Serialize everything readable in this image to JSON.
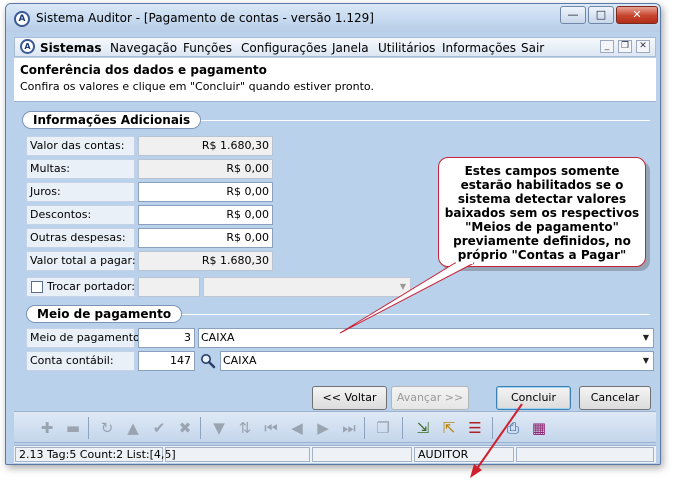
{
  "window": {
    "title": "Sistema Auditor - [Pagamento de contas - versão 1.129]",
    "minimize": "—",
    "maximize": "□",
    "close": "✕"
  },
  "menu": {
    "app_icon": "A",
    "items": [
      "Sistemas",
      "Navegação",
      "Funções",
      "Configurações",
      "Janela",
      "Utilitários",
      "Informações",
      "Sair"
    ],
    "mdi_minimize": "_",
    "mdi_restore": "❐",
    "mdi_close": "✕"
  },
  "header": {
    "title": "Conferência dos dados e pagamento",
    "subtitle": "Confira os valores e clique em \"Concluir\" quando estiver pronto."
  },
  "info_group": {
    "label": "Informações Adicionais",
    "fields": [
      {
        "label": "Valor das contas:",
        "value": "R$ 1.680,30"
      },
      {
        "label": "Multas:",
        "value": "R$ 0,00"
      },
      {
        "label": "Juros:",
        "value": "R$ 0,00"
      },
      {
        "label": "Descontos:",
        "value": "R$ 0,00"
      },
      {
        "label": "Outras despesas:",
        "value": "R$ 0,00"
      },
      {
        "label": "Valor total a pagar:",
        "value": "R$ 1.680,30"
      }
    ],
    "trocar_portador": "Trocar portador:"
  },
  "payment_group": {
    "label": "Meio de pagamento",
    "meio_label": "Meio de pagamento:",
    "meio_code": "3",
    "meio_value": "CAIXA",
    "conta_label": "Conta contábil:",
    "conta_code": "147",
    "conta_value": "CAIXA"
  },
  "callout": {
    "lines": [
      "Estes campos somente",
      "estarão habilitados se o",
      "sistema detectar valores",
      "baixados sem os respectivos",
      "\"Meios de pagamento\"",
      "previamente definidos, no",
      "próprio \"Contas a Pagar\""
    ]
  },
  "buttons": {
    "voltar": "<< Voltar",
    "avancar": "Avançar >>",
    "concluir": "Concluir",
    "cancelar": "Cancelar"
  },
  "status": {
    "info": "2.13 Tag:5 Count:2 List:[4,5]",
    "user": "AUDITOR"
  },
  "colors": {
    "window_bg": "#b9d1ea",
    "callout_border": "#c8243a",
    "arrow": "#d0202e"
  }
}
